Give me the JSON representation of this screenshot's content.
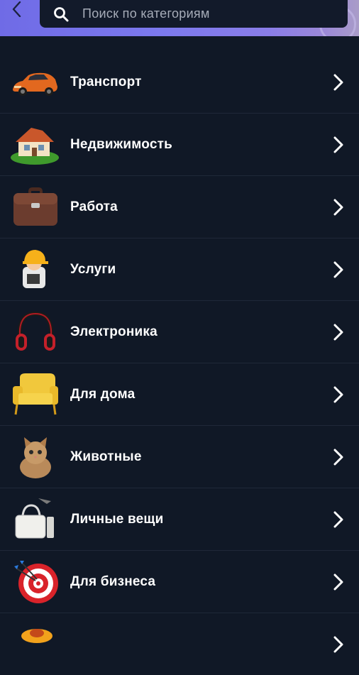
{
  "header": {
    "back_icon": "chevron-left-icon",
    "search_icon": "search-icon",
    "search_placeholder": "Поиск по категориям"
  },
  "categories": [
    {
      "label": "Транспорт",
      "icon": "car-icon"
    },
    {
      "label": "Недвижимость",
      "icon": "house-icon"
    },
    {
      "label": "Работа",
      "icon": "briefcase-icon"
    },
    {
      "label": "Услуги",
      "icon": "worker-hardhat-icon"
    },
    {
      "label": "Электроника",
      "icon": "headphones-icon"
    },
    {
      "label": "Для дома",
      "icon": "armchair-icon"
    },
    {
      "label": "Животные",
      "icon": "kitten-icon"
    },
    {
      "label": "Личные вещи",
      "icon": "handbag-icon"
    },
    {
      "label": "Для бизнеса",
      "icon": "target-darts-icon"
    },
    {
      "label": "",
      "icon": "hobby-icon"
    }
  ],
  "colors": {
    "background": "#101826",
    "header_gradient_start": "#6f6be6",
    "search_bg": "#121a2a",
    "divider": "#1f2838"
  }
}
